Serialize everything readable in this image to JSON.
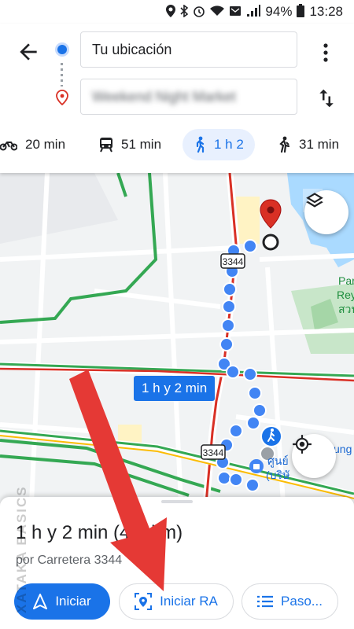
{
  "status_bar": {
    "battery": "94%",
    "time": "13:28"
  },
  "header": {
    "origin_value": "Tu ubicación",
    "destination_value": "Weekend Night Market"
  },
  "modes": [
    {
      "name": "motorcycle",
      "label": "20 min"
    },
    {
      "name": "transit",
      "label": "51 min"
    },
    {
      "name": "walking",
      "label": "1 h 2",
      "active": true
    },
    {
      "name": "ride",
      "label": "31 min"
    }
  ],
  "map": {
    "route_time_label": "1 h y 2 min",
    "road_labels": [
      "3344",
      "3344"
    ],
    "poi_text": [
      "Par",
      "Rey",
      "สวน",
      "ศูนย์",
      "(บริษั",
      "ung"
    ]
  },
  "sheet": {
    "summary": "1 h y 2 min (4,5 km)",
    "via": "por Carretera 3344",
    "start_label": "Iniciar",
    "ar_label": "Iniciar RA",
    "steps_label": "Paso..."
  },
  "watermark": "XATAKA BASICS",
  "colors": {
    "accent": "#1a73e8",
    "arrow": "#e53935",
    "traffic_green": "#34a853",
    "traffic_red": "#d93025"
  }
}
